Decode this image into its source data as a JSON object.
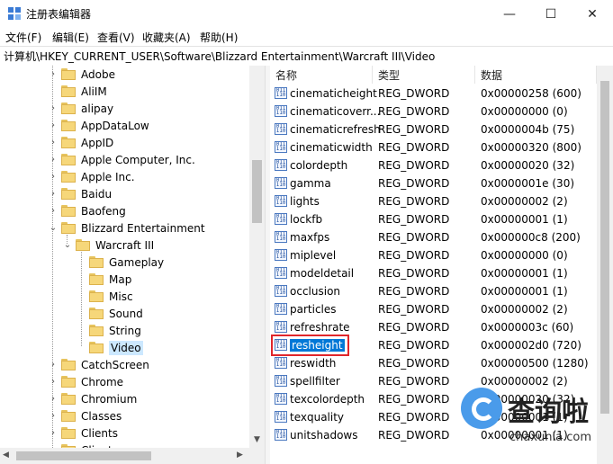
{
  "window": {
    "title": "注册表编辑器",
    "minimize_icon": "—",
    "maximize_icon": "☐",
    "close_icon": "✕"
  },
  "menu": [
    "文件(F)",
    "编辑(E)",
    "查看(V)",
    "收藏夹(A)",
    "帮助(H)"
  ],
  "address": "计算机\\HKEY_CURRENT_USER\\Software\\Blizzard Entertainment\\Warcraft III\\Video",
  "tree": [
    {
      "label": "Adobe",
      "expander": "›"
    },
    {
      "label": "AliIM",
      "expander": ""
    },
    {
      "label": "alipay",
      "expander": "›"
    },
    {
      "label": "AppDataLow",
      "expander": "›"
    },
    {
      "label": "AppID",
      "expander": "›"
    },
    {
      "label": "Apple Computer, Inc.",
      "expander": "›"
    },
    {
      "label": "Apple Inc.",
      "expander": "›"
    },
    {
      "label": "Baidu",
      "expander": "›"
    },
    {
      "label": "Baofeng",
      "expander": "›"
    },
    {
      "label": "Blizzard Entertainment",
      "expander": "⌄"
    },
    {
      "label": "Warcraft III",
      "expander": "⌄"
    },
    {
      "label": "Gameplay",
      "expander": ""
    },
    {
      "label": "Map",
      "expander": ""
    },
    {
      "label": "Misc",
      "expander": ""
    },
    {
      "label": "Sound",
      "expander": ""
    },
    {
      "label": "String",
      "expander": ""
    },
    {
      "label": "Video",
      "expander": ""
    },
    {
      "label": "CatchScreen",
      "expander": "›"
    },
    {
      "label": "Chrome",
      "expander": "›"
    },
    {
      "label": "Chromium",
      "expander": "›"
    },
    {
      "label": "Classes",
      "expander": "›"
    },
    {
      "label": "Clients",
      "expander": "›"
    },
    {
      "label": "Clients",
      "expander": "›"
    }
  ],
  "columns": {
    "name": "名称",
    "type": "类型",
    "data": "数据"
  },
  "values": [
    {
      "name": "cinematicheight",
      "type": "REG_DWORD",
      "data": "0x00000258 (600)"
    },
    {
      "name": "cinematicoverr...",
      "type": "REG_DWORD",
      "data": "0x00000000 (0)"
    },
    {
      "name": "cinematicrefresh",
      "type": "REG_DWORD",
      "data": "0x0000004b (75)"
    },
    {
      "name": "cinematicwidth",
      "type": "REG_DWORD",
      "data": "0x00000320 (800)"
    },
    {
      "name": "colordepth",
      "type": "REG_DWORD",
      "data": "0x00000020 (32)"
    },
    {
      "name": "gamma",
      "type": "REG_DWORD",
      "data": "0x0000001e (30)"
    },
    {
      "name": "lights",
      "type": "REG_DWORD",
      "data": "0x00000002 (2)"
    },
    {
      "name": "lockfb",
      "type": "REG_DWORD",
      "data": "0x00000001 (1)"
    },
    {
      "name": "maxfps",
      "type": "REG_DWORD",
      "data": "0x000000c8 (200)"
    },
    {
      "name": "miplevel",
      "type": "REG_DWORD",
      "data": "0x00000000 (0)"
    },
    {
      "name": "modeldetail",
      "type": "REG_DWORD",
      "data": "0x00000001 (1)"
    },
    {
      "name": "occlusion",
      "type": "REG_DWORD",
      "data": "0x00000001 (1)"
    },
    {
      "name": "particles",
      "type": "REG_DWORD",
      "data": "0x00000002 (2)"
    },
    {
      "name": "refreshrate",
      "type": "REG_DWORD",
      "data": "0x0000003c (60)"
    },
    {
      "name": "resheight",
      "type": "REG_DWORD",
      "data": "0x000002d0 (720)"
    },
    {
      "name": "reswidth",
      "type": "REG_DWORD",
      "data": "0x00000500 (1280)"
    },
    {
      "name": "spellfilter",
      "type": "REG_DWORD",
      "data": "0x00000002 (2)"
    },
    {
      "name": "texcolordepth",
      "type": "REG_DWORD",
      "data": "0x00000020 (32)"
    },
    {
      "name": "texquality",
      "type": "REG_DWORD",
      "data": "0x00000001 (1)"
    },
    {
      "name": "unitshadows",
      "type": "REG_DWORD",
      "data": "0x00000001 (1)"
    }
  ],
  "reg_icon_text": "011 110",
  "watermark": {
    "text": "查询啦",
    "url": "chaxunla.com"
  },
  "colors": {
    "selection": "#0078d7",
    "highlight_box": "#e0262b",
    "folder": "#f6d77a"
  }
}
